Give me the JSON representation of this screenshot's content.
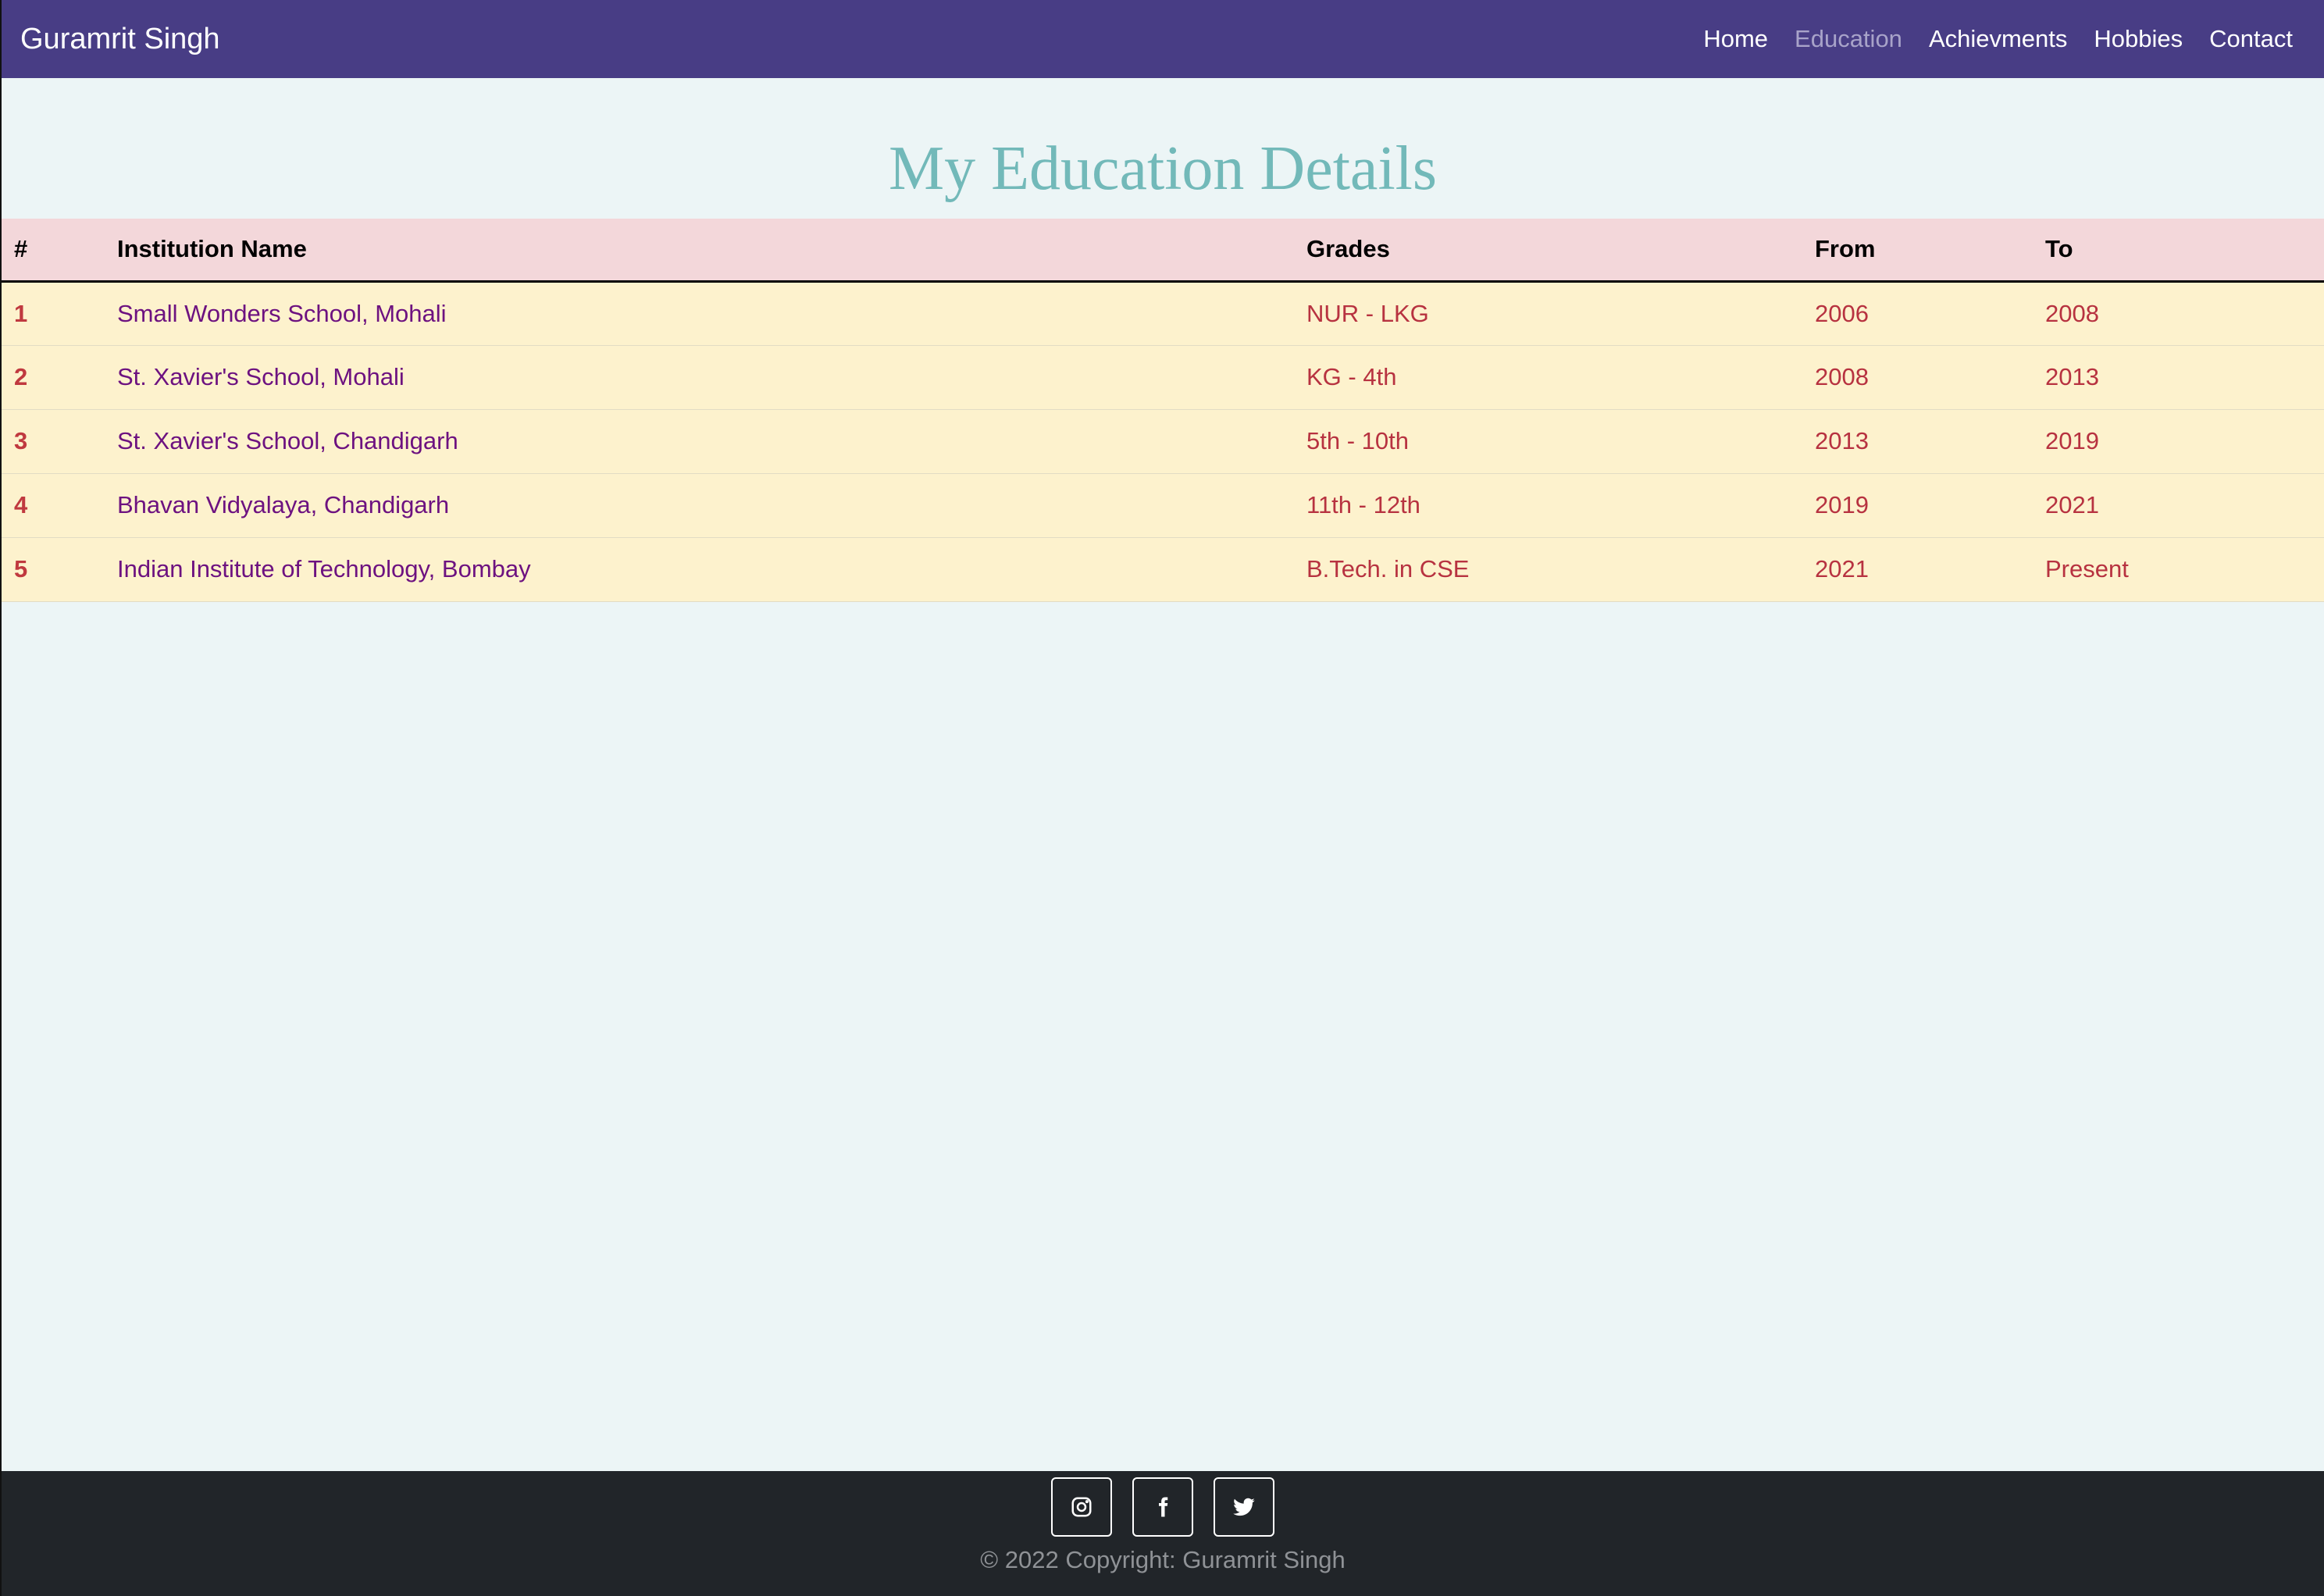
{
  "navbar": {
    "brand": "Guramrit Singh",
    "links": [
      {
        "label": "Home",
        "active": false
      },
      {
        "label": "Education",
        "active": true
      },
      {
        "label": "Achievments",
        "active": false
      },
      {
        "label": "Hobbies",
        "active": false
      },
      {
        "label": "Contact",
        "active": false
      }
    ]
  },
  "main": {
    "title": "My Education Details",
    "table": {
      "headers": [
        "#",
        "Institution Name",
        "Grades",
        "From",
        "To"
      ],
      "rows": [
        {
          "num": "1",
          "institution": "Small Wonders School, Mohali",
          "grades": "NUR - LKG",
          "from": "2006",
          "to": "2008"
        },
        {
          "num": "2",
          "institution": "St. Xavier's School, Mohali",
          "grades": "KG - 4th",
          "from": "2008",
          "to": "2013"
        },
        {
          "num": "3",
          "institution": "St. Xavier's School, Chandigarh",
          "grades": "5th - 10th",
          "from": "2013",
          "to": "2019"
        },
        {
          "num": "4",
          "institution": "Bhavan Vidyalaya, Chandigarh",
          "grades": "11th - 12th",
          "from": "2019",
          "to": "2021"
        },
        {
          "num": "5",
          "institution": "Indian Institute of Technology, Bombay",
          "grades": "B.Tech. in CSE",
          "from": "2021",
          "to": "Present"
        }
      ]
    }
  },
  "footer": {
    "social": [
      {
        "icon": "instagram-icon"
      },
      {
        "icon": "facebook-icon"
      },
      {
        "icon": "twitter-icon"
      }
    ],
    "copyright": "© 2022 Copyright: Guramrit Singh"
  },
  "colors": {
    "navbar_bg": "#483d85",
    "page_bg": "#ecf5f6",
    "title": "#72b9b9",
    "table_header_bg": "#f3d7da",
    "table_row_bg": "#fdf2cd",
    "institution_text": "#6d1280",
    "value_text": "#b73240",
    "footer_bg": "#212529"
  }
}
